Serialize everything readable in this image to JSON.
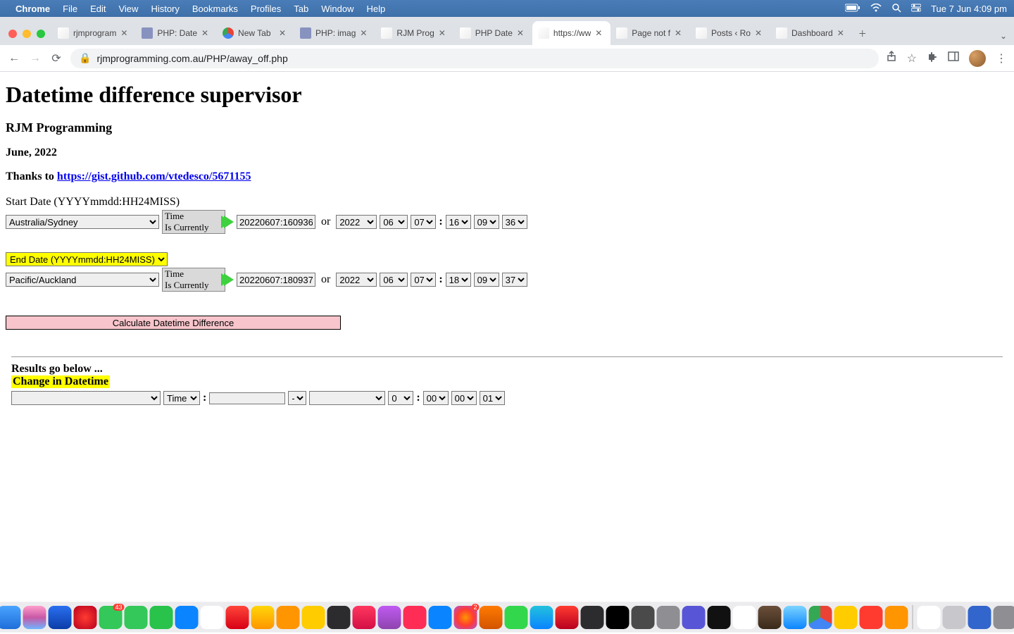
{
  "menubar": {
    "app": "Chrome",
    "items": [
      "File",
      "Edit",
      "View",
      "History",
      "Bookmarks",
      "Profiles",
      "Tab",
      "Window",
      "Help"
    ],
    "clock": "Tue 7 Jun  4:09 pm"
  },
  "tabs": [
    {
      "title": "rjmprogram",
      "fav": "rocket"
    },
    {
      "title": "PHP: Date",
      "fav": "php"
    },
    {
      "title": "New Tab",
      "fav": "chrome"
    },
    {
      "title": "PHP: imag",
      "fav": "php"
    },
    {
      "title": "RJM Prog",
      "fav": "rocket"
    },
    {
      "title": "PHP Date",
      "fav": "rocket"
    },
    {
      "title": "https://ww",
      "fav": "rocket",
      "active": true
    },
    {
      "title": "Page not f",
      "fav": "rocket"
    },
    {
      "title": "Posts ‹ Ro",
      "fav": "rocket"
    },
    {
      "title": "Dashboard",
      "fav": "rocket"
    }
  ],
  "toolbar": {
    "url": "rjmprogramming.com.au/PHP/away_off.php"
  },
  "page": {
    "h1": "Datetime difference supervisor",
    "h2": "RJM Programming",
    "h3": "June, 2022",
    "thanks_prefix": "Thanks to ",
    "thanks_link": "https://gist.github.com/vtedesco/5671155",
    "start_label": "Start Date (YYYYmmdd:HH24MISS)",
    "timebox_l1": "Time",
    "timebox_l2": "Is Currently",
    "start": {
      "tz": "Australia/Sydney",
      "dt": "20220607:160936",
      "or": "or",
      "year": "2022",
      "mon": "06",
      "day": "07",
      "hh": "16",
      "mm": "09",
      "ss": "36"
    },
    "end_select_label": "End Date (YYYYmmdd:HH24MISS)",
    "end": {
      "tz": "Pacific/Auckland",
      "dt": "20220607:180937",
      "or": "or",
      "year": "2022",
      "mon": "06",
      "day": "07",
      "hh": "18",
      "mm": "09",
      "ss": "37"
    },
    "calc_btn": "Calculate Datetime Difference",
    "results_label": "Results go below ...",
    "change_label": "Change in Datetime",
    "bottom": {
      "tz": "",
      "time": "Time",
      "dt": "",
      "sign": "-",
      "year": "",
      "mon": "0",
      "hh": "00",
      "mm": "00",
      "ss": "01"
    },
    "colon": ":"
  },
  "dock_colors": [
    "linear-gradient(#4aa3ff,#1e6fd9)",
    "linear-gradient(#ff9ecb,#c858a5,#6fb4ff)",
    "linear-gradient(#2a6ff0,#0b3da8)",
    "radial-gradient(circle,#ff3b30,#b8001f)",
    "#34c759",
    "#34c759",
    "#29c24a",
    "#0a84ff",
    "#fff",
    "linear-gradient(#ff453a,#d70015)",
    "linear-gradient(#ffd60a,#ff9500)",
    "#ff9500",
    "#ffcc00",
    "#2c2c2e",
    "linear-gradient(#ff375f,#d30f45)",
    "linear-gradient(#bf5af2,#8e44ad)",
    "#ff2d55",
    "#0a84ff",
    "radial-gradient(circle,#ff9500,#ff3b30,#af52de)",
    "linear-gradient(#ff7a00,#d35400)",
    "#32d74b",
    "linear-gradient(#22c1dc,#0a84ff)",
    "linear-gradient(#ff3b30,#b8001f)",
    "#2c2c2e",
    "#000",
    "#4a4a4a",
    "#8e8e93",
    "#5856d6",
    "#111",
    "#fff",
    "linear-gradient(#6b4f3a,#3a2a1a)",
    "linear-gradient(#7bd3ff,#0a84ff)",
    "conic-gradient(#ea4335 0 120deg,#4285f4 120deg 240deg,#34a853 240deg)",
    "#ffcc00",
    "#ff3b30",
    "#ff9500"
  ],
  "dock_right": [
    "#fff",
    "#c7c7cc",
    "#36c",
    "#8e8e93"
  ]
}
